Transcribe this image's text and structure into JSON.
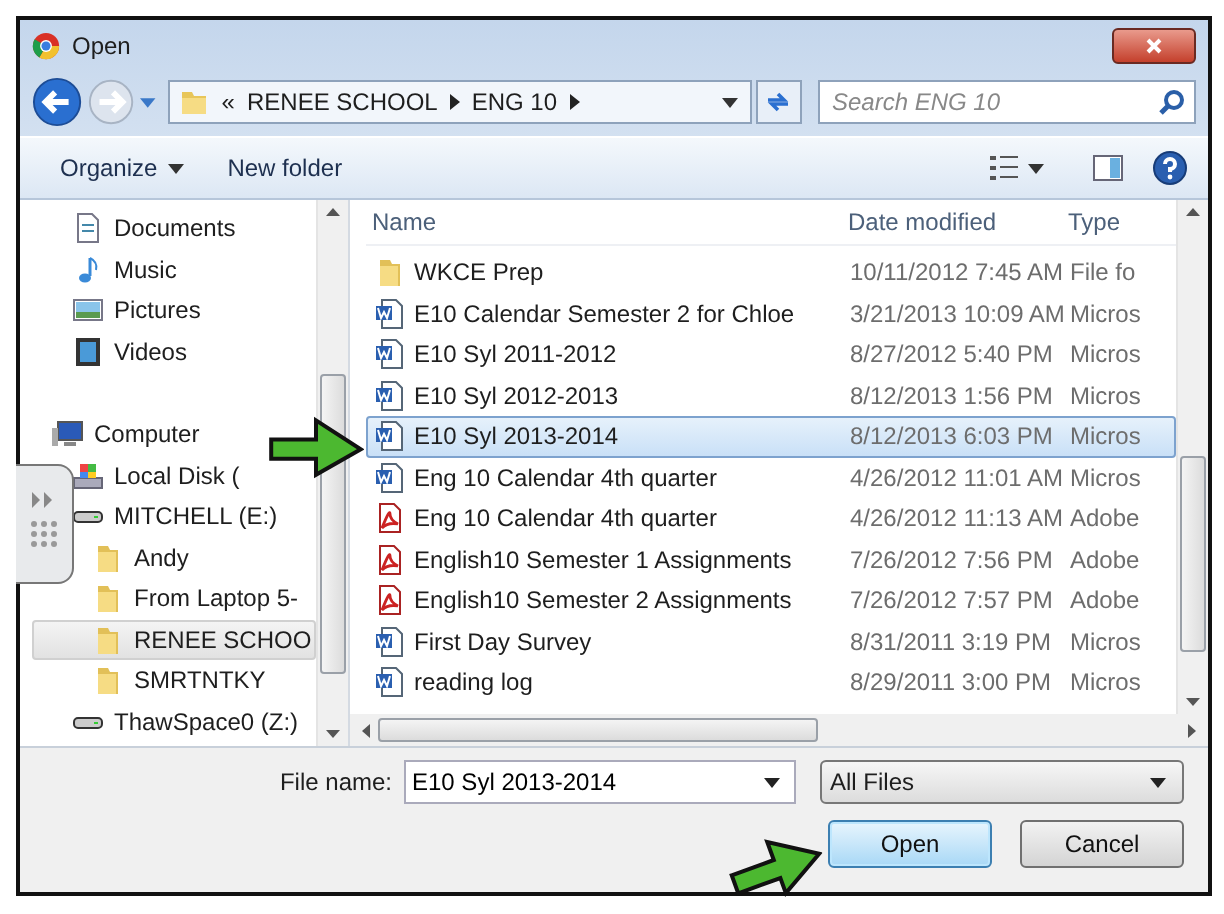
{
  "window": {
    "title": "Open"
  },
  "nav": {
    "overflow": "«",
    "breadcrumb": [
      "RENEE SCHOOL",
      "ENG 10"
    ],
    "search": {
      "placeholder": "Search ENG 10"
    }
  },
  "toolbar": {
    "organize": "Organize",
    "new_folder": "New folder"
  },
  "sidebar": {
    "sections": [
      {
        "items": [
          {
            "label": "Documents",
            "kind": "documents",
            "selected": false
          },
          {
            "label": "Music",
            "kind": "music",
            "selected": false
          },
          {
            "label": "Pictures",
            "kind": "pictures",
            "selected": false
          },
          {
            "label": "Videos",
            "kind": "videos",
            "selected": false
          }
        ]
      },
      {
        "items": [
          {
            "label": "Computer",
            "kind": "computer",
            "selected": false,
            "children": [
              {
                "label": "Local Disk (",
                "kind": "disk",
                "selected": false
              },
              {
                "label": "MITCHELL (E:)",
                "kind": "drive",
                "selected": false,
                "children": [
                  {
                    "label": "Andy",
                    "kind": "folder",
                    "selected": false
                  },
                  {
                    "label": "From Laptop 5-",
                    "kind": "folder",
                    "selected": false
                  },
                  {
                    "label": "RENEE SCHOO",
                    "kind": "folder",
                    "selected": true
                  },
                  {
                    "label": "SMRTNTKY",
                    "kind": "folder",
                    "selected": false
                  }
                ]
              },
              {
                "label": "ThawSpace0 (Z:)",
                "kind": "drive",
                "selected": false
              }
            ]
          }
        ]
      }
    ]
  },
  "table": {
    "columns": [
      "Name",
      "Date modified",
      "Type"
    ],
    "rows": [
      {
        "name": "WKCE Prep",
        "date": "10/11/2012 7:45 AM",
        "type": "File fo",
        "kind": "folder",
        "selected": false
      },
      {
        "name": "E10 Calendar Semester 2 for Chloe",
        "date": "3/21/2013 10:09 AM",
        "type": "Micros",
        "kind": "word",
        "selected": false
      },
      {
        "name": "E10 Syl 2011-2012",
        "date": "8/27/2012 5:40 PM",
        "type": "Micros",
        "kind": "word",
        "selected": false
      },
      {
        "name": "E10 Syl 2012-2013",
        "date": "8/12/2013 1:56 PM",
        "type": "Micros",
        "kind": "word",
        "selected": false
      },
      {
        "name": "E10 Syl 2013-2014",
        "date": "8/12/2013 6:03 PM",
        "type": "Micros",
        "kind": "word",
        "selected": true
      },
      {
        "name": "Eng 10 Calendar 4th quarter",
        "date": "4/26/2012 11:01 AM",
        "type": "Micros",
        "kind": "word",
        "selected": false
      },
      {
        "name": "Eng 10 Calendar 4th quarter",
        "date": "4/26/2012 11:13 AM",
        "type": "Adobe",
        "kind": "pdf",
        "selected": false
      },
      {
        "name": "English10 Semester 1 Assignments",
        "date": "7/26/2012 7:56 PM",
        "type": "Adobe",
        "kind": "pdf",
        "selected": false
      },
      {
        "name": "English10 Semester 2 Assignments",
        "date": "7/26/2012 7:57 PM",
        "type": "Adobe",
        "kind": "pdf",
        "selected": false
      },
      {
        "name": "First Day Survey",
        "date": "8/31/2011 3:19 PM",
        "type": "Micros",
        "kind": "word",
        "selected": false
      },
      {
        "name": "reading log",
        "date": "8/29/2011 3:00 PM",
        "type": "Micros",
        "kind": "word",
        "selected": false
      }
    ]
  },
  "footer": {
    "file_name_label": "File name:",
    "file_name": "E10 Syl 2013-2014",
    "filter": "All Files",
    "buttons": [
      {
        "label": "Open",
        "default": true
      },
      {
        "label": "Cancel",
        "default": false
      }
    ]
  }
}
